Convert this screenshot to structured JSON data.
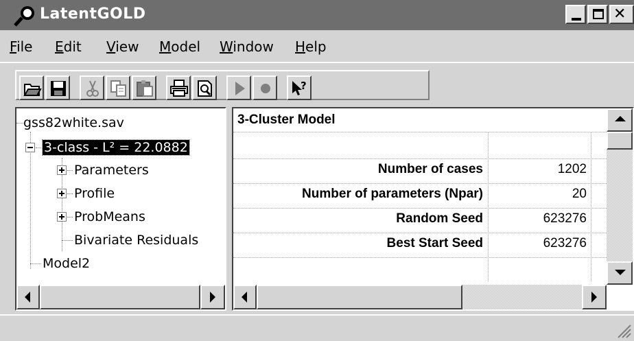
{
  "window": {
    "title": "LatentGOLD",
    "app_icon": "magnifier-icon"
  },
  "menu": [
    {
      "label": "File",
      "accel": "F",
      "rest": "ile"
    },
    {
      "label": "Edit",
      "accel": "E",
      "rest": "dit"
    },
    {
      "label": "View",
      "accel": "V",
      "rest": "iew"
    },
    {
      "label": "Model",
      "accel": "M",
      "rest": "odel"
    },
    {
      "label": "Window",
      "accel": "W",
      "rest": "indow"
    },
    {
      "label": "Help",
      "accel": "H",
      "rest": "elp"
    }
  ],
  "toolbar": {
    "buttons": [
      "open-icon",
      "save-icon",
      "cut-icon",
      "copy-icon",
      "paste-icon",
      "print-icon",
      "print-preview-icon",
      "run-icon",
      "stop-icon",
      "context-help-icon"
    ]
  },
  "tree": {
    "root": "gss82white.sav",
    "model1": "3-class - L² = 22.0882",
    "children": [
      "Parameters",
      "Profile",
      "ProbMeans",
      "Bivariate Residuals"
    ],
    "model2": "Model2"
  },
  "grid": {
    "title": "3-Cluster Model",
    "rows": [
      {
        "label": "Number of cases",
        "value": "1202"
      },
      {
        "label": "Number of parameters (Npar)",
        "value": "20"
      },
      {
        "label": "Random Seed",
        "value": "623276"
      },
      {
        "label": "Best Start Seed",
        "value": "623276"
      }
    ]
  },
  "colors": {
    "titlebar": "#6e6e6e",
    "selection": "#000000",
    "face": "#d4d4d4"
  }
}
